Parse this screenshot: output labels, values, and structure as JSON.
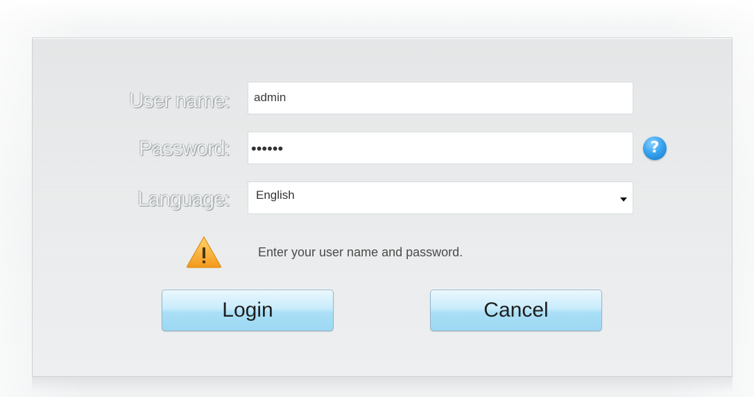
{
  "form": {
    "username_label": "User name:",
    "username_value": "admin",
    "password_label": "Password:",
    "password_masked": "••••••",
    "language_label": "Language:",
    "language_selected": "English",
    "help_icon": "question-mark-icon",
    "message": "Enter your user name and password.",
    "warning_icon": "warning-triangle-icon"
  },
  "buttons": {
    "login_label": "Login",
    "cancel_label": "Cancel"
  },
  "colors": {
    "help_icon": "#2b95e3",
    "warning_icon": "#f5a623",
    "button_gradient_top": "#eaf7fd",
    "button_gradient_bottom": "#9dd8f3"
  }
}
